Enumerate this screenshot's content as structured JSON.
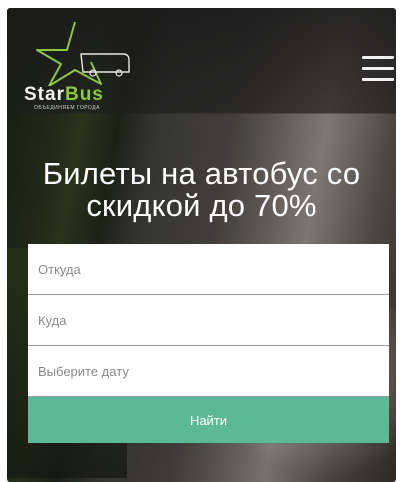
{
  "brand": {
    "name_part1": "Star",
    "name_part2": "Bus",
    "tagline": "ОБЪЕДИНЯЕМ ГОРОДА",
    "accent_color": "#8dc63f"
  },
  "header": {
    "menu_icon": "hamburger-menu-icon"
  },
  "hero": {
    "title": "Билеты на автобус со скидкой до 70%"
  },
  "search": {
    "from_placeholder": "Откуда",
    "to_placeholder": "Куда",
    "date_placeholder": "Выберите дату",
    "submit_label": "Найти",
    "submit_color": "#5bb996"
  }
}
